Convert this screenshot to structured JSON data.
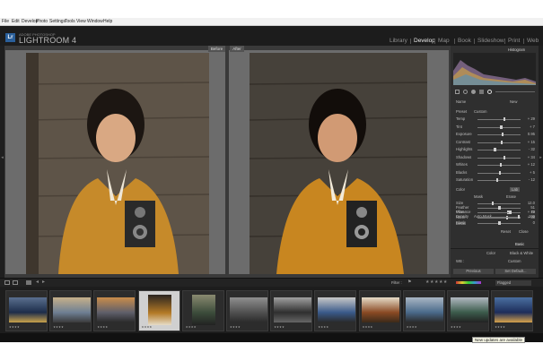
{
  "menu": [
    "File",
    "Edit",
    "Develop",
    "Photo",
    "Settings",
    "Tools",
    "View",
    "Window",
    "Help"
  ],
  "identity": {
    "logo": "Lr",
    "vendor": "ADOBE PHOTOSHOP",
    "app_name": "LIGHTROOM 4"
  },
  "modules": [
    {
      "label": "Library",
      "active": false
    },
    {
      "label": "Develop",
      "active": true
    },
    {
      "label": "Map",
      "active": false
    },
    {
      "label": "Book",
      "active": false
    },
    {
      "label": "Slideshow",
      "active": false
    },
    {
      "label": "Print",
      "active": false
    },
    {
      "label": "Web",
      "active": false
    }
  ],
  "compare": {
    "before": "Before",
    "after": "After"
  },
  "right_panel": {
    "histogram_label": "Histogram",
    "basic": {
      "name_label": "Name",
      "name_value": "New",
      "preset_label": "Preset",
      "preset_value": "Custom",
      "sliders": [
        {
          "label": "Temp",
          "value": "+ 29",
          "pos": 0.62
        },
        {
          "label": "Tint",
          "value": "+ 7",
          "pos": 0.55
        },
        {
          "label": "Exposure",
          "value": "0.95",
          "pos": 0.58
        },
        {
          "label": "Contrast",
          "value": "+ 15",
          "pos": 0.56
        },
        {
          "label": "Highlights",
          "value": "- 32",
          "pos": 0.4
        },
        {
          "label": "Shadows",
          "value": "+ 34",
          "pos": 0.62
        },
        {
          "label": "Whites",
          "value": "+ 12",
          "pos": 0.54
        },
        {
          "label": "Blacks",
          "value": "+ 5",
          "pos": 0.52
        },
        {
          "label": "Saturation",
          "value": "- 12",
          "pos": 0.45
        }
      ],
      "color_label": "Color",
      "color_value": "Lab",
      "sliders2": [
        {
          "label": "Vibrance",
          "value": "+ 42",
          "pos": 0.7
        },
        {
          "label": "Noise",
          "value": "+ 38",
          "pos": 0.68
        },
        {
          "label": "Blank",
          "value": "0",
          "pos": 0.5
        }
      ],
      "detail_label": "Detail",
      "mask_label": "Mask",
      "mask_value": "Erase",
      "sliders3": [
        {
          "label": "Size",
          "value": "12.0",
          "pos": 0.35
        },
        {
          "label": "Feather",
          "value": "51",
          "pos": 0.5
        },
        {
          "label": "Flow",
          "value": "79",
          "pos": 0.75
        },
        {
          "label": "Density",
          "value": "100",
          "pos": 0.95
        }
      ],
      "auto_mask": "Auto Mask",
      "reset": "Reset",
      "close": "Close",
      "basic_label": "Basic"
    },
    "treatment_color": "Color",
    "treatment_bw": "Black & White",
    "wb_label": "WB :",
    "wb_value": "Custom",
    "previous_button": "Previous",
    "set_default_button": "Set Default..."
  },
  "filmstrip": {
    "filter_label": "Filter :",
    "flagged_label": "Flagged",
    "thumbs": [
      {
        "stars": "★★★★"
      },
      {
        "stars": "★★★★"
      },
      {
        "stars": "★★★★"
      },
      {
        "stars": "★★★★"
      },
      {
        "stars": "★★★★"
      },
      {
        "stars": "★★★★"
      },
      {
        "stars": "★★★★"
      },
      {
        "stars": "★★★★"
      },
      {
        "stars": "★★★★"
      },
      {
        "stars": "★★★★"
      },
      {
        "stars": "★★★★"
      },
      {
        "stars": "★★★★"
      }
    ]
  },
  "status": {
    "tooltip": "New updates are available"
  }
}
